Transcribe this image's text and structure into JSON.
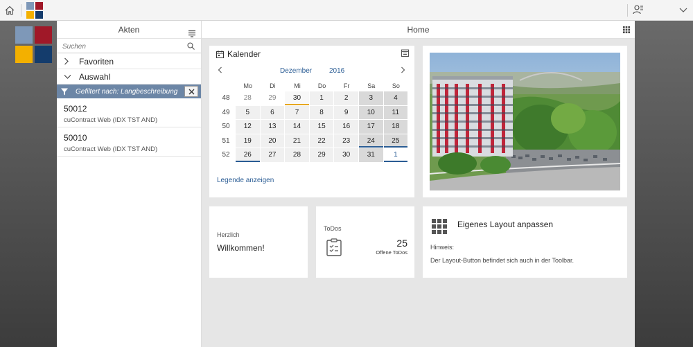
{
  "colors": {
    "logo_tl": "#7e98b8",
    "logo_tr": "#a01828",
    "logo_bl": "#f3b000",
    "logo_br": "#143c6c",
    "accent_blue": "#2a5c94",
    "filter_bar": "#6c86a6",
    "today_marker": "#e6a820"
  },
  "sidebar": {
    "title": "Akten",
    "search_placeholder": "Suchen",
    "groups": [
      {
        "label": "Favoriten",
        "expanded": false
      },
      {
        "label": "Auswahl",
        "expanded": true
      }
    ],
    "filter_text": "Gefiltert nach: Langbeschreibung",
    "results": [
      {
        "number": "50012",
        "description": "cuContract Web (IDX TST AND)"
      },
      {
        "number": "50010",
        "description": "cuContract Web (IDX TST AND)"
      }
    ]
  },
  "main": {
    "title": "Home"
  },
  "calendar": {
    "title": "Kalender",
    "month": "Dezember",
    "year": "2016",
    "weekdays": [
      "Mo",
      "Di",
      "Mi",
      "Do",
      "Fr",
      "Sa",
      "So"
    ],
    "weeks": [
      {
        "week": "48",
        "days": [
          {
            "d": "28",
            "t": "out"
          },
          {
            "d": "29",
            "t": "out"
          },
          {
            "d": "30",
            "t": "today"
          },
          {
            "d": "1",
            "t": ""
          },
          {
            "d": "2",
            "t": ""
          },
          {
            "d": "3",
            "t": "we"
          },
          {
            "d": "4",
            "t": "we"
          }
        ]
      },
      {
        "week": "49",
        "days": [
          {
            "d": "5",
            "t": ""
          },
          {
            "d": "6",
            "t": ""
          },
          {
            "d": "7",
            "t": ""
          },
          {
            "d": "8",
            "t": ""
          },
          {
            "d": "9",
            "t": ""
          },
          {
            "d": "10",
            "t": "we"
          },
          {
            "d": "11",
            "t": "we"
          }
        ]
      },
      {
        "week": "50",
        "days": [
          {
            "d": "12",
            "t": ""
          },
          {
            "d": "13",
            "t": ""
          },
          {
            "d": "14",
            "t": ""
          },
          {
            "d": "15",
            "t": ""
          },
          {
            "d": "16",
            "t": ""
          },
          {
            "d": "17",
            "t": "we"
          },
          {
            "d": "18",
            "t": "we"
          }
        ]
      },
      {
        "week": "51",
        "days": [
          {
            "d": "19",
            "t": ""
          },
          {
            "d": "20",
            "t": ""
          },
          {
            "d": "21",
            "t": ""
          },
          {
            "d": "22",
            "t": ""
          },
          {
            "d": "23",
            "t": ""
          },
          {
            "d": "24",
            "t": "we sel"
          },
          {
            "d": "25",
            "t": "we sel"
          }
        ]
      },
      {
        "week": "52",
        "days": [
          {
            "d": "26",
            "t": "sel"
          },
          {
            "d": "27",
            "t": ""
          },
          {
            "d": "28",
            "t": ""
          },
          {
            "d": "29",
            "t": ""
          },
          {
            "d": "30",
            "t": ""
          },
          {
            "d": "31",
            "t": "we"
          },
          {
            "d": "1",
            "t": "out1 sel"
          }
        ]
      }
    ],
    "legend_link": "Legende anzeigen"
  },
  "welcome": {
    "small": "Herzlich",
    "big": "Willkommen!"
  },
  "todos": {
    "title": "ToDos",
    "count": "25",
    "count_label": "Offene ToDos"
  },
  "layout_tile": {
    "title": "Eigenes Layout anpassen",
    "hint_label": "Hinweis:",
    "hint_text": "Der Layout-Button befindet sich auch in der Toolbar."
  }
}
